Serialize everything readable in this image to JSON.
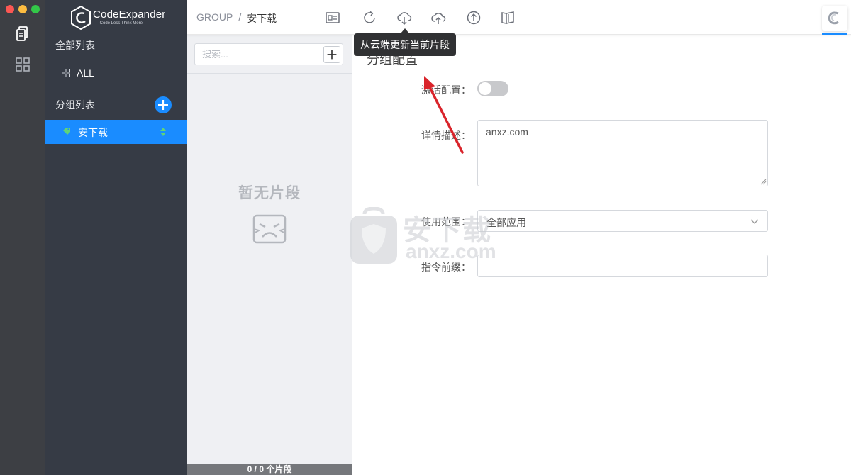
{
  "window": {
    "controls": [
      "close",
      "minimize",
      "zoom"
    ]
  },
  "rail": {
    "icons": [
      "snippets-icon",
      "apps-grid-icon"
    ]
  },
  "sidebar": {
    "logo_title": "CodeExpander",
    "logo_subtitle": "- Code Less Think More -",
    "all_section_title": "全部列表",
    "all_item_label": "ALL",
    "group_section_title": "分组列表",
    "groups": [
      {
        "label": "安下载",
        "selected": true
      }
    ]
  },
  "header": {
    "breadcrumb_root": "GROUP",
    "breadcrumb_separator": "/",
    "breadcrumb_current": "安下载",
    "toolbar_icons": [
      "card-icon",
      "refresh-icon",
      "cloud-download-icon",
      "cloud-upload-icon",
      "arrow-up-circle-icon",
      "book-icon"
    ],
    "tooltip": "从云端更新当前片段"
  },
  "snippets": {
    "search_placeholder": "搜索...",
    "empty_text": "暂无片段",
    "footer": "0 / 0 个片段"
  },
  "form": {
    "title": "分组配置",
    "activate_label": "激活配置",
    "activate_on": false,
    "description_label": "详情描述",
    "description_value": "anxz.com",
    "scope_label": "使用范围",
    "scope_value": "全部应用",
    "prefix_label": "指令前缀",
    "prefix_value": ""
  },
  "watermark": {
    "cn": "安下载",
    "en": "anxz.com"
  },
  "colors": {
    "accent": "#1a8cff",
    "sidebar": "#363b45",
    "rail": "#3d3f44",
    "annotation_arrow": "#d9242b"
  }
}
